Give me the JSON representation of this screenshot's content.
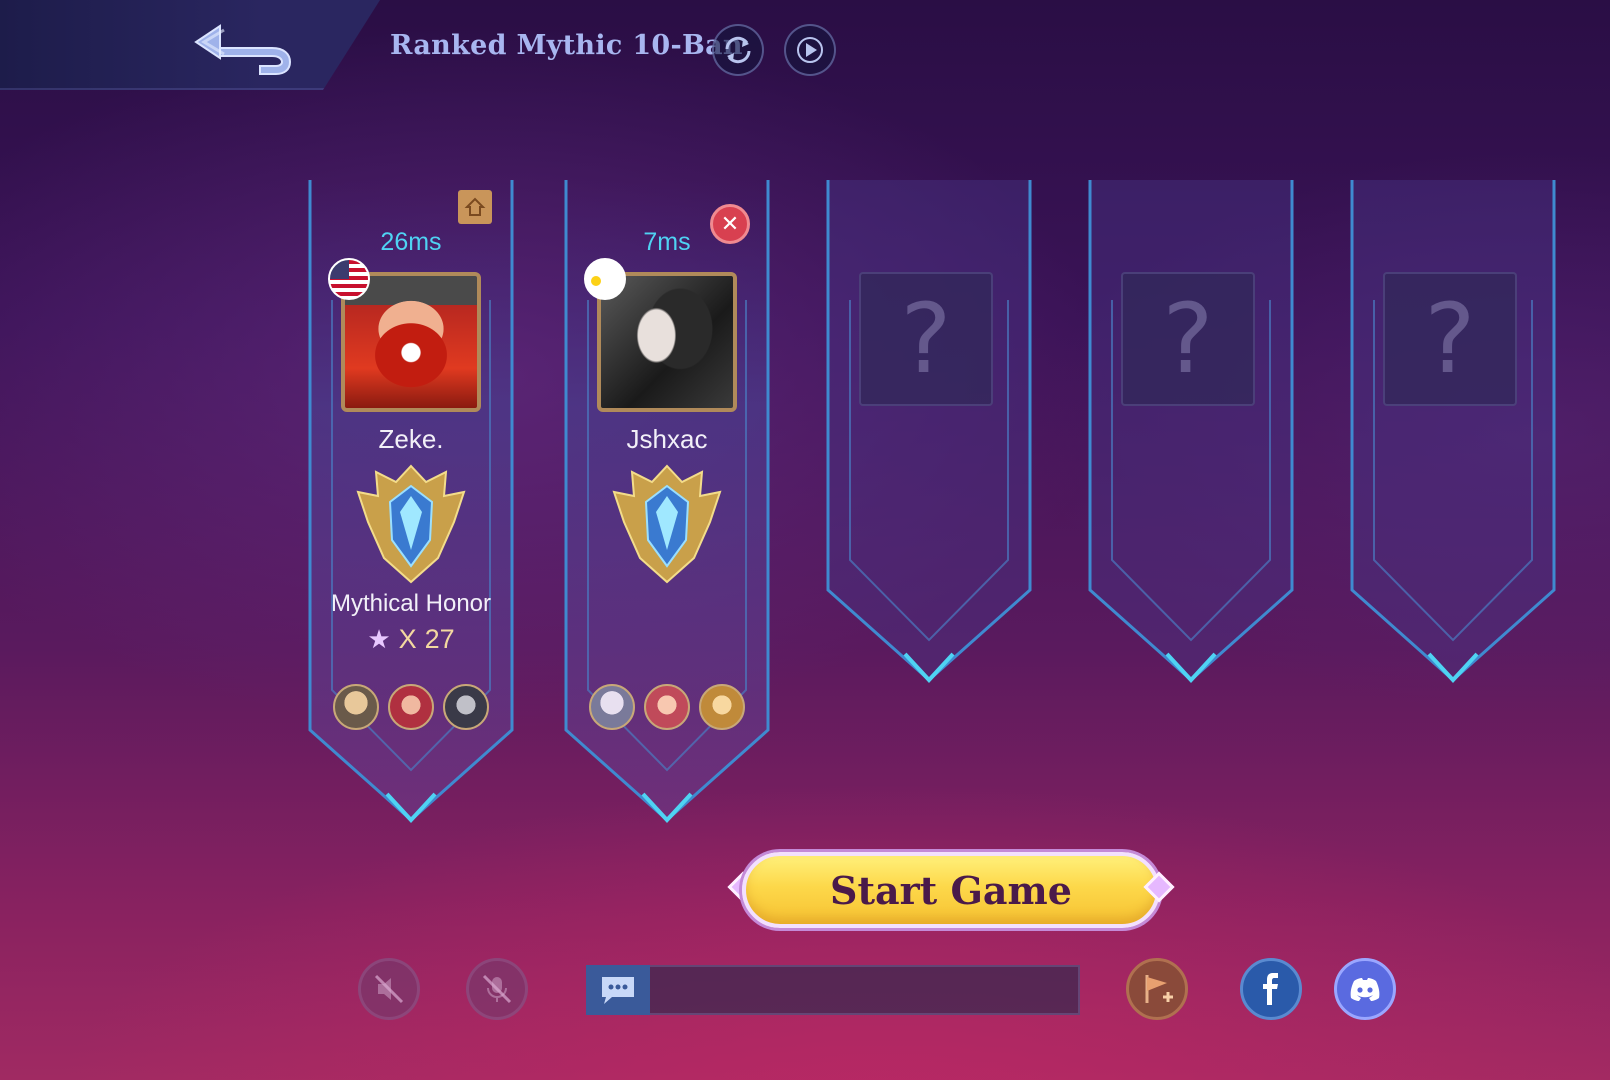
{
  "header": {
    "mode_title": "Ranked Mythic 10-Ban",
    "back_icon": "back-arrow-icon",
    "refresh_icon": "refresh-icon",
    "replay_icon": "play-icon"
  },
  "players": [
    {
      "ping": "26ms",
      "name": "Zeke.",
      "flag": "us-flag-icon",
      "rank": "Mythical Honor",
      "stars_prefix": "X",
      "stars": "27",
      "is_host": true
    },
    {
      "ping": "7ms",
      "name": "Jshxac",
      "flag": "ph-flag-icon",
      "rank": "",
      "stars_prefix": "",
      "stars": "",
      "is_host": false
    }
  ],
  "empty_slots": [
    {
      "placeholder": "?"
    },
    {
      "placeholder": "?"
    },
    {
      "placeholder": "?"
    }
  ],
  "actions": {
    "start_label": "Start Game"
  },
  "colors": {
    "ping": "#4fd3f3",
    "start_button": "#fdd84a",
    "title": "#a8b6f0"
  }
}
